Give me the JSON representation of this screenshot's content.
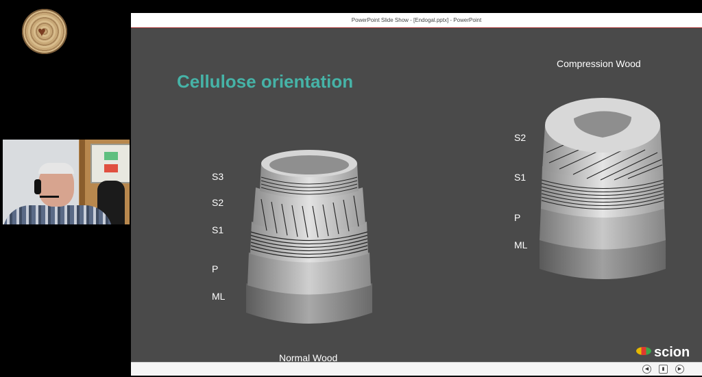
{
  "window": {
    "title": "PowerPoint Slide Show - [Endogal.pptx] - PowerPoint"
  },
  "slide": {
    "title": "Cellulose orientation",
    "normal_wood": {
      "caption": "Normal Wood",
      "layers": [
        "S3",
        "S2",
        "S1",
        "P",
        "ML"
      ]
    },
    "compression_wood": {
      "caption": "Compression Wood",
      "layers": [
        "S2",
        "S1",
        "P",
        "ML"
      ]
    },
    "brand": "scion"
  },
  "icons": {
    "app_logo": "tree-ring-heart-icon",
    "prev": "previous-slide-icon",
    "menu": "slide-menu-icon",
    "next": "next-slide-icon"
  },
  "colors": {
    "title_teal": "#46b3a7",
    "slide_bg": "#4a4a4a",
    "accent_red": "#a83232"
  }
}
